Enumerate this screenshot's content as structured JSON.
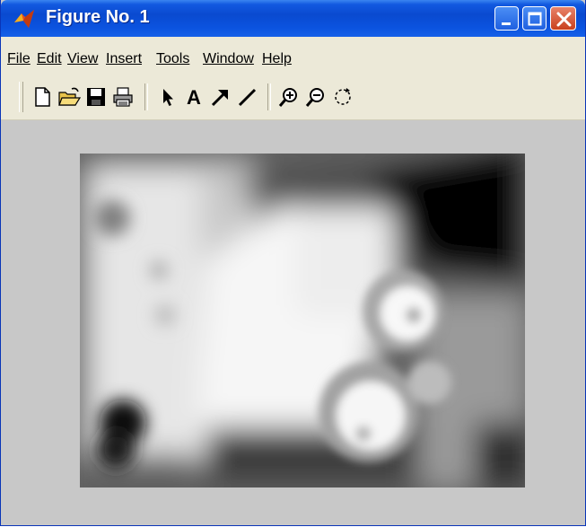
{
  "window": {
    "title": "Figure No. 1",
    "title_bar_color": "#0a4ad0",
    "figure_background": "#c8c8c8",
    "controls": [
      "minimize-icon",
      "maximize-icon",
      "close-icon"
    ]
  },
  "menu": {
    "items": [
      {
        "label": "File"
      },
      {
        "label": "Edit"
      },
      {
        "label": "View"
      },
      {
        "label": "Insert"
      },
      {
        "label": "Tools"
      },
      {
        "label": "Window"
      },
      {
        "label": "Help"
      }
    ]
  },
  "toolbar": {
    "tools": [
      "new-figure-icon",
      "open-file-icon",
      "save-icon",
      "print-icon",
      "edit-plot-arrow-icon",
      "insert-text-icon",
      "insert-arrow-icon",
      "insert-line-icon",
      "zoom-in-icon",
      "zoom-out-icon",
      "rotate-3d-icon"
    ],
    "text_tool_glyph": "A"
  },
  "figure": {
    "image": "blurred-grayscale-photo"
  }
}
